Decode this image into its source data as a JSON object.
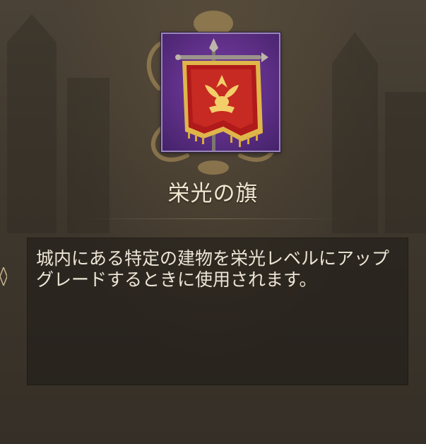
{
  "item": {
    "name": "栄光の旗",
    "icon": "glory-banner-icon",
    "description": "城内にある特定の建物を栄光レベルにアップグレードするときに使用されます。"
  },
  "colors": {
    "text": "#f2e6cf",
    "icon_background": "#5e2f86",
    "banner_red": "#b01a1a",
    "banner_gold": "#e0b64a"
  }
}
